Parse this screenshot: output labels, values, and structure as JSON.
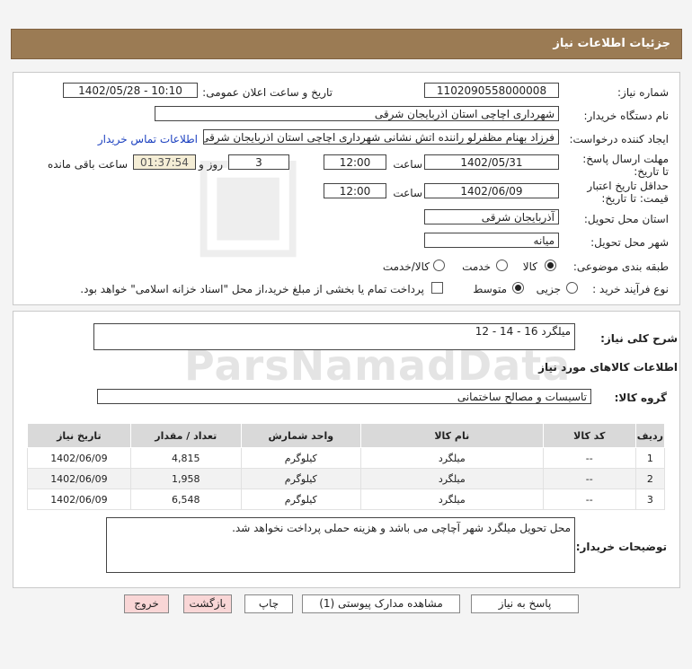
{
  "header": {
    "title": "جزئیات اطلاعات نیاز"
  },
  "form": {
    "need_number_label": "شماره نیاز:",
    "need_number": "1102090558000008",
    "announce_label": "تاریخ و ساعت اعلان عمومی:",
    "announce_value": "1402/05/28 - 10:10",
    "buyer_org_label": "نام دستگاه خریدار:",
    "buyer_org": "شهرداری اچاچی استان اذربایجان شرقی",
    "creator_label": "ایجاد کننده درخواست:",
    "creator": "فرزاد بهنام مظفرلو راننده اتش نشانی شهرداری اچاچی استان اذربایجان شرقی",
    "contact_link": "اطلاعات تماس خریدار",
    "deadline_label": "مهلت ارسال پاسخ: تا تاریخ:",
    "deadline_date": "1402/05/31",
    "hour_label": "ساعت",
    "deadline_time": "12:00",
    "days_value": "3",
    "days_label": "روز و",
    "remaining_time": "01:37:54",
    "remaining_label": "ساعت باقی مانده",
    "validity_label": "حداقل تاریخ اعتبار قیمت: تا تاریخ:",
    "validity_date": "1402/06/09",
    "validity_time": "12:00",
    "province_label": "استان محل تحویل:",
    "province": "آذربایجان شرقی",
    "city_label": "شهر محل تحویل:",
    "city": "میانه",
    "category_label": "طبقه بندی موضوعی:",
    "category_options": [
      "کالا",
      "خدمت",
      "کالا/خدمت"
    ],
    "purchase_label": "نوع فرآیند خرید :",
    "purchase_options": [
      "جزیی",
      "متوسط"
    ],
    "payment_note": "پرداخت تمام یا بخشی از مبلغ خرید،از محل \"اسناد خزانه اسلامی\" خواهد بود."
  },
  "details": {
    "summary_label": "شرح کلی نیاز:",
    "summary": "میلگرد 16 - 14 - 12",
    "goods_info_title": "اطلاعات کالاهای مورد نیاز",
    "goods_group_label": "گروه کالا:",
    "goods_group": "تاسیسات و مصالح ساختمانی",
    "table": {
      "headers": [
        "ردیف",
        "کد کالا",
        "نام کالا",
        "واحد شمارش",
        "تعداد / مقدار",
        "تاریخ نیاز"
      ],
      "rows": [
        [
          "1",
          "--",
          "میلگرد",
          "کیلوگرم",
          "4,815",
          "1402/06/09"
        ],
        [
          "2",
          "--",
          "میلگرد",
          "کیلوگرم",
          "1,958",
          "1402/06/09"
        ],
        [
          "3",
          "--",
          "میلگرد",
          "کیلوگرم",
          "6,548",
          "1402/06/09"
        ]
      ]
    },
    "buyer_notes_label": "توضیحات خریدار:",
    "buyer_notes": "محل تحویل میلگرد شهر آچاچی می باشد و هزینه حملی پرداخت نخواهد شد."
  },
  "buttons": {
    "reply": "پاسخ به نیاز",
    "attachments": "مشاهده مدارک پیوستی (1)",
    "print": "چاپ",
    "back": "بازگشت",
    "exit": "خروج"
  },
  "watermark": {
    "main": "ParsNamadData"
  }
}
